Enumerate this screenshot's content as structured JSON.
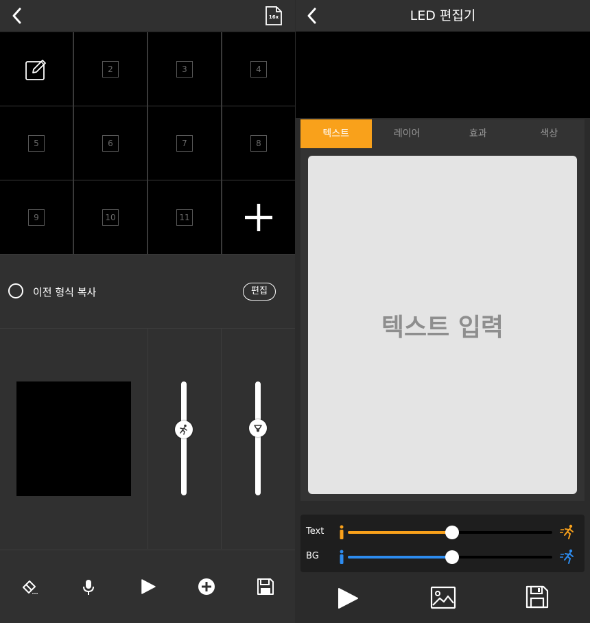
{
  "left": {
    "header": {
      "file_badge": "16x"
    },
    "grid": {
      "cells": [
        "2",
        "3",
        "4",
        "5",
        "6",
        "7",
        "8",
        "9",
        "10",
        "11"
      ]
    },
    "copy_label": "이전 형식 복사",
    "edit_label": "편집",
    "speed_slider_level": 0.58,
    "brightness_slider_level": 0.59
  },
  "right": {
    "title": "LED 편집기",
    "tabs": [
      "텍스트",
      "레이어",
      "효과",
      "색상"
    ],
    "active_tab": "텍스트",
    "text_placeholder": "텍스트 입력",
    "speed": {
      "text_label": "Text",
      "text_level": 0.51,
      "bg_label": "BG",
      "bg_level": 0.51,
      "text_color": "#f9a11b",
      "bg_color": "#2d8cf0"
    }
  }
}
